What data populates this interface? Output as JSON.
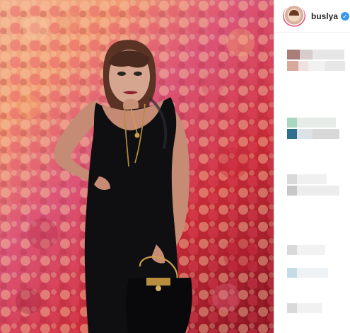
{
  "post": {
    "username": "buslya",
    "verified_glyph": "✓",
    "photo_description": "person-portrait-image"
  },
  "icons": {
    "avatar": "profile-avatar-icon",
    "verified": "verified-badge-icon"
  },
  "colors": {
    "verified_blue": "#3897f0",
    "username_text": "#262626"
  }
}
